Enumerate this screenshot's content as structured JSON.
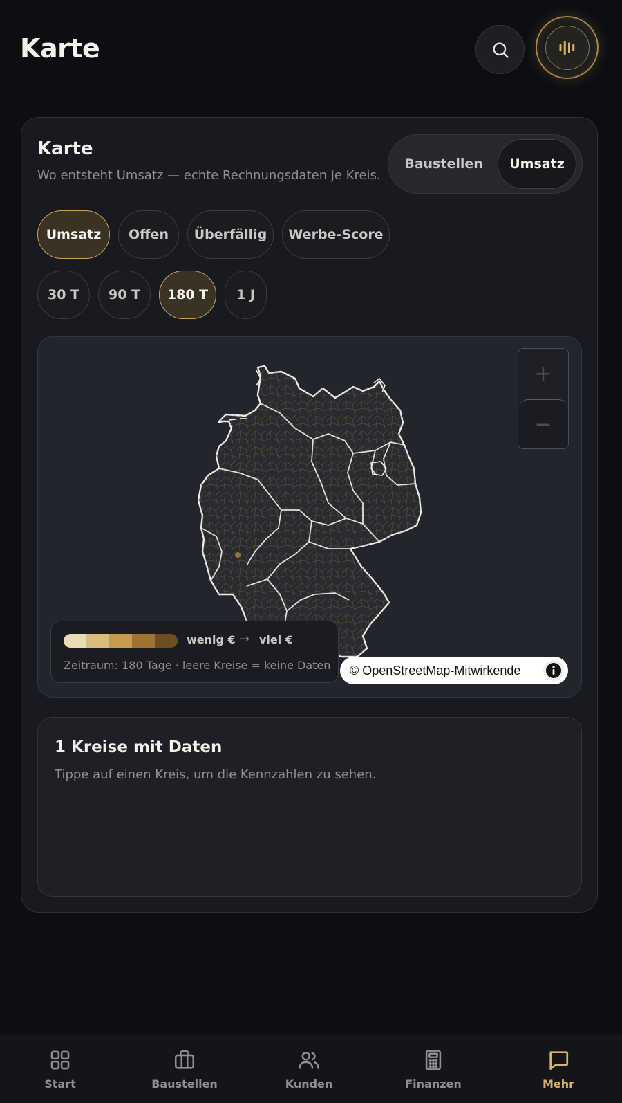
{
  "header": {
    "title": "Karte"
  },
  "card": {
    "title": "Karte",
    "subtitle": "Wo entsteht Umsatz — echte Rechnungsdaten je Kreis.",
    "view_toggle": {
      "options": [
        "Baustellen",
        "Umsatz"
      ],
      "selected": "Umsatz"
    },
    "metric_chips": [
      "Umsatz",
      "Offen",
      "Überfällig",
      "Werbe-Score"
    ],
    "metric_selected": "Umsatz",
    "period_chips": [
      "30 T",
      "90 T",
      "180 T",
      "1 J"
    ],
    "period_selected": "180 T"
  },
  "map": {
    "zoom_in": "+",
    "zoom_out": "−",
    "legend": {
      "low": "wenig €",
      "arrow": "→",
      "high": "viel €",
      "note": "Zeitraum: 180 Tage · leere Kreise = keine Daten",
      "colors": [
        "#e9dcb6",
        "#d8bd7e",
        "#c69b4d",
        "#a07334",
        "#6f4d22"
      ]
    },
    "attribution": "© OpenStreetMap-Mitwirkende"
  },
  "details": {
    "title": "1 Kreise mit Daten",
    "hint": "Tippe auf einen Kreis, um die Kennzahlen zu sehen."
  },
  "nav": {
    "items": [
      {
        "label": "Start",
        "icon": "grid-icon"
      },
      {
        "label": "Baustellen",
        "icon": "briefcase-icon"
      },
      {
        "label": "Kunden",
        "icon": "users-icon"
      },
      {
        "label": "Finanzen",
        "icon": "calculator-icon"
      },
      {
        "label": "Mehr",
        "icon": "message-icon"
      }
    ],
    "active": "Mehr"
  },
  "colors": {
    "accent": "#c9a35a",
    "background": "#0d0e11",
    "card": "#191a1f"
  }
}
